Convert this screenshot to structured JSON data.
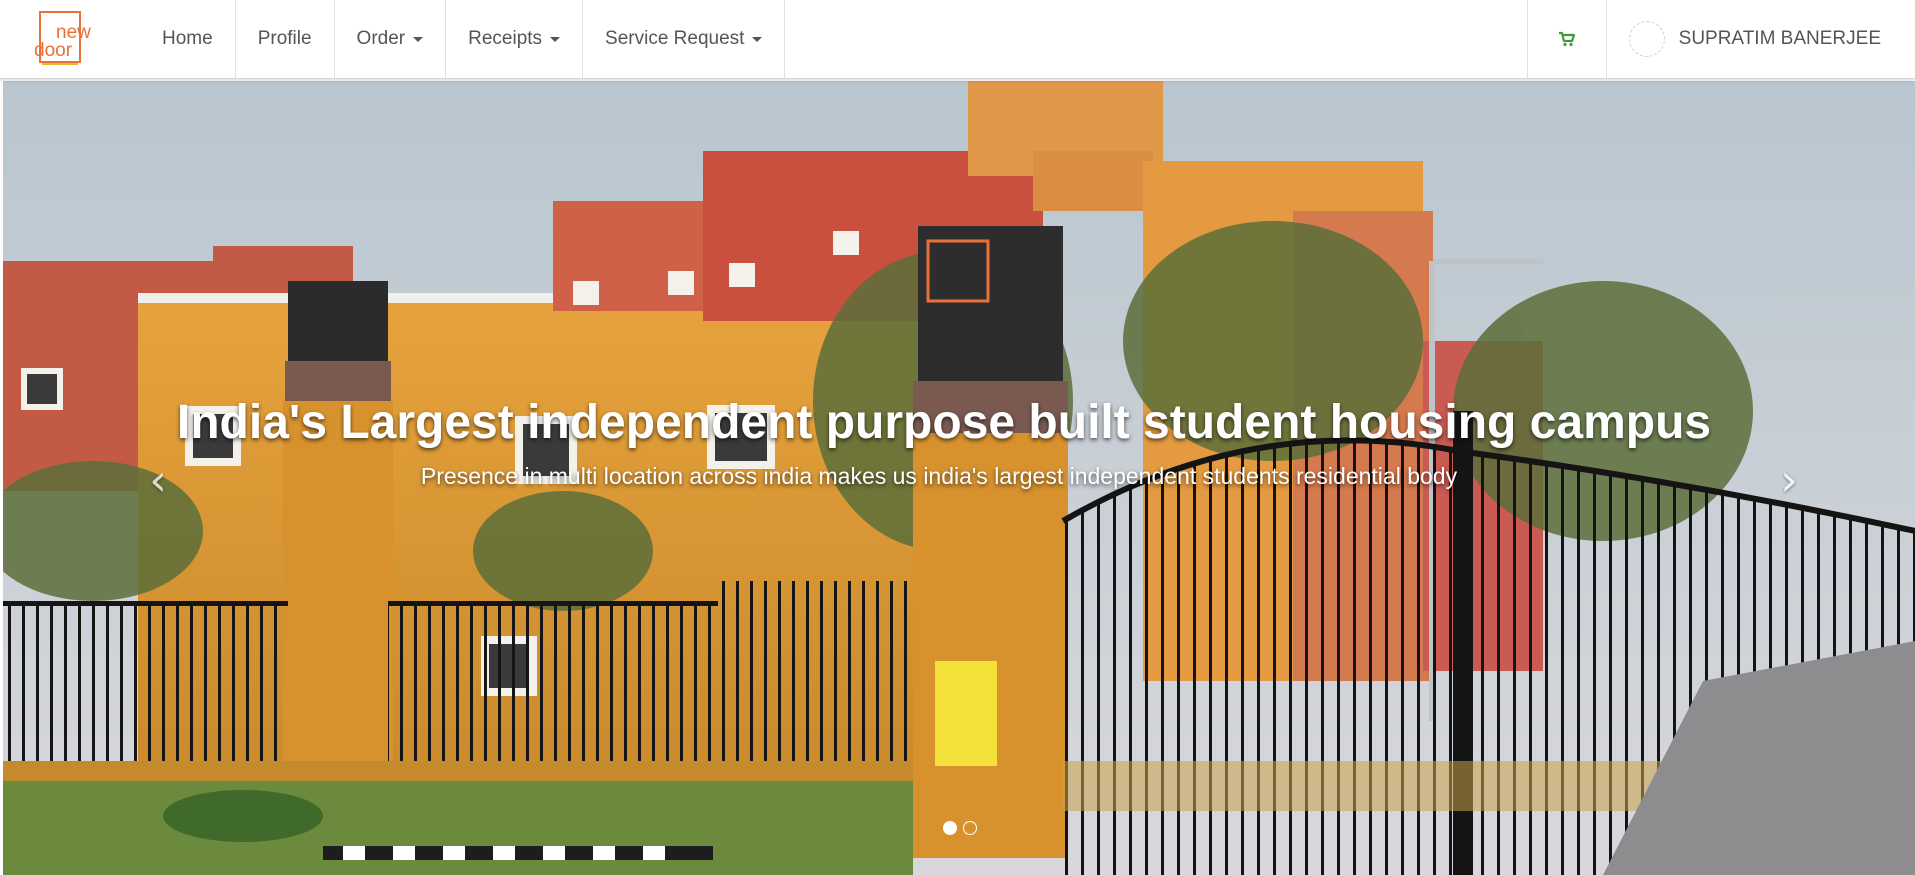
{
  "brand": {
    "logo_text_top": "new",
    "logo_text_bottom": "door",
    "color": "#e8713a",
    "accent": "#f2b233"
  },
  "nav": {
    "items": [
      {
        "label": "Home"
      },
      {
        "label": "Profile"
      },
      {
        "label": "Order"
      },
      {
        "label": "Receipts"
      },
      {
        "label": "Service Request"
      }
    ],
    "cart_icon": "shopping-cart-icon",
    "cart_color": "#3c9a3c",
    "user_name": "SUPRATIM BANERJEE"
  },
  "hero": {
    "title": "India's Largest independent purpose built student housing campus",
    "subtitle": "Presence in multi location across india makes us india's largest independent students residential body",
    "prev_icon": "chevron-left-icon",
    "next_icon": "chevron-right-icon",
    "slides_total": 2,
    "active_slide": 1
  }
}
